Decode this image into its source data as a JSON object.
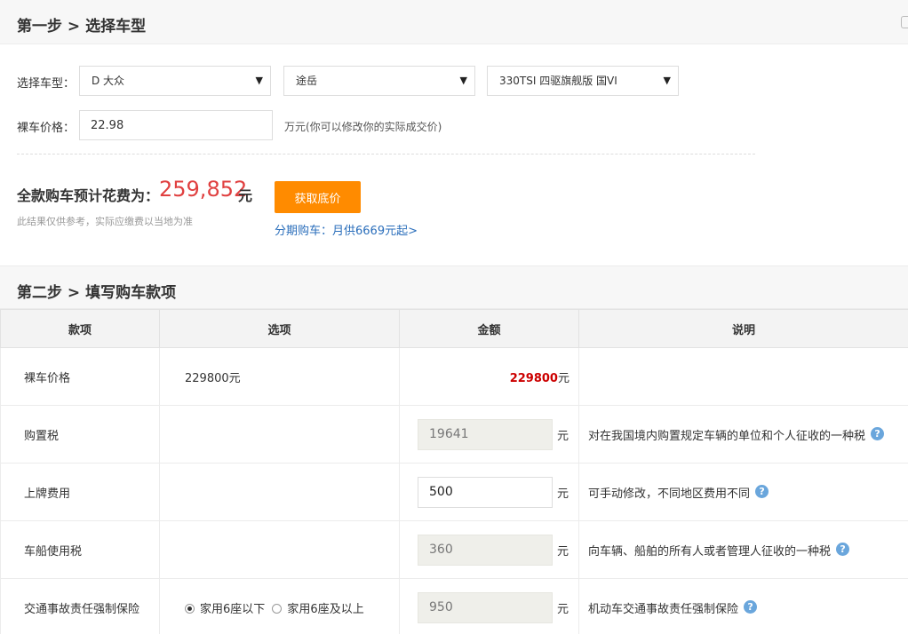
{
  "step1": {
    "title": "第一步 > 选择车型",
    "model_label": "选择车型：",
    "brand": "D 大众",
    "series": "途岳",
    "variant": "330TSI 四驱旗舰版 国VI",
    "price_label": "裸车价格：",
    "price_value": "22.98",
    "price_note": "万元(你可以修改你的实际成交价)",
    "total_label": "全款购车预计花费为：",
    "total_value": "259,852",
    "total_unit": "元",
    "disclaimer": "此结果仅供参考，实际应缴费以当地为准",
    "button_label": "获取底价",
    "installment_link": "分期购车：月供6669元起>"
  },
  "step2": {
    "title": "第二步 > 填写购车款项",
    "headers": [
      "款项",
      "选项",
      "金额",
      "说明"
    ],
    "rows": [
      {
        "name": "裸车价格",
        "option": "229800元",
        "amount": "229800",
        "unit": "元",
        "desc": ""
      },
      {
        "name": "购置税",
        "option": "",
        "amount": "19641",
        "unit": "元",
        "desc": "对在我国境内购置规定车辆的单位和个人征收的一种税"
      },
      {
        "name": "上牌费用",
        "option": "",
        "amount": "500",
        "unit": "元",
        "desc": "可手动修改，不同地区费用不同"
      },
      {
        "name": "车船使用税",
        "option": "",
        "amount": "360",
        "unit": "元",
        "desc": "向车辆、船舶的所有人或者管理人征收的一种税"
      },
      {
        "name": "交通事故责任强制保险",
        "option_a": "家用6座以下",
        "option_b": "家用6座及以上",
        "amount": "950",
        "unit": "元",
        "desc": "机动车交通事故责任强制保险"
      }
    ]
  },
  "icons": {
    "help": "?"
  },
  "colors": {
    "accent": "#ff8b00",
    "price_red": "#e04040",
    "link_blue": "#2a6ebb"
  }
}
